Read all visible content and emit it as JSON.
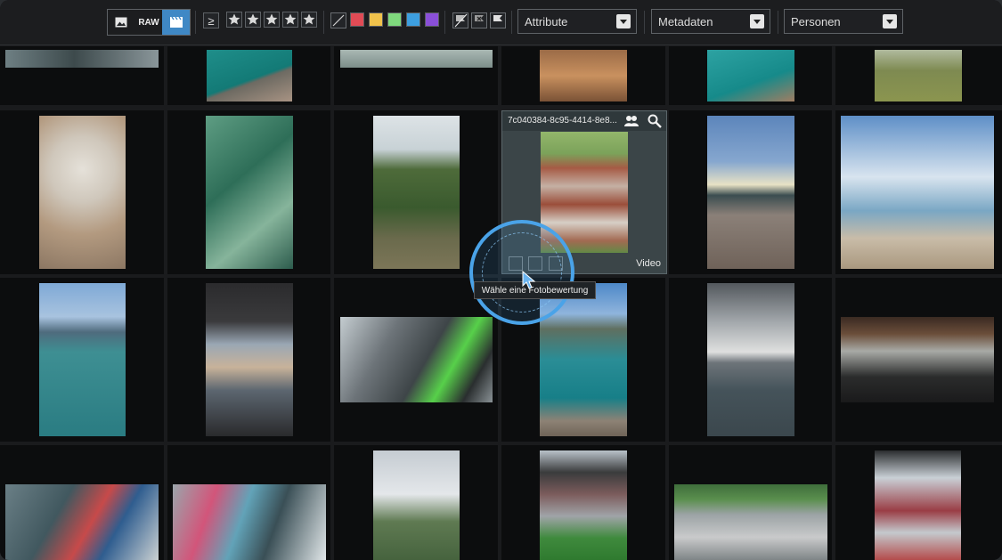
{
  "toolbar": {
    "media_type": [
      {
        "name": "image-icon",
        "label": ""
      },
      {
        "name": "raw",
        "label": "RAW"
      },
      {
        "name": "video-icon",
        "label": ""
      }
    ],
    "rating_operator": "≥",
    "stars": 5,
    "color_labels": [
      "#e14b55",
      "#f0c24b",
      "#7fd97d",
      "#3d9fe0",
      "#8a4fd8"
    ],
    "attribute_select": "Attribute",
    "metadata_select": "Metadaten",
    "persons_select": "Personen"
  },
  "hovered_item": {
    "filename": "7c040384-8c95-4414-8e8...",
    "type_label": "Video",
    "tooltip": "Wähle eine Fotobewertung"
  },
  "colors": {
    "accent": "#3f88c5",
    "cursor_ring": "#4aa3e8"
  }
}
